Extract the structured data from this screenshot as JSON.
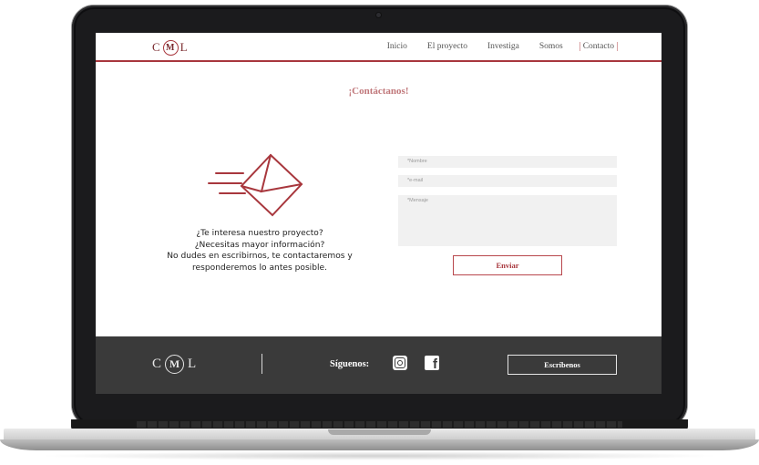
{
  "nav": {
    "logo": {
      "left": "C",
      "middle": "M",
      "right": "L"
    },
    "items": [
      {
        "label": "Inicio"
      },
      {
        "label": "El proyecto"
      },
      {
        "label": "Investiga"
      },
      {
        "label": "Somos"
      },
      {
        "label": "Contacto"
      }
    ]
  },
  "contact": {
    "title": "¡Contáctanos!",
    "lines": [
      "¿Te interesa nuestro proyecto?",
      "¿Necesitas mayor información?",
      "No dudes en escribirnos, te contactaremos y",
      "responderemos lo antes posible."
    ],
    "form": {
      "name_placeholder": "*Nombre",
      "email_placeholder": "*e-mail",
      "message_placeholder": "*Mensaje",
      "send_label": "Enviar"
    }
  },
  "footer": {
    "logo": {
      "left": "C",
      "middle": "M",
      "right": "L"
    },
    "follow_label": "Síguenos:",
    "write_label": "Escríbenos",
    "icons": [
      "instagram-icon",
      "facebook-icon"
    ]
  },
  "colors": {
    "accent": "#a8373d",
    "footer_bg": "#3a3a3a"
  }
}
